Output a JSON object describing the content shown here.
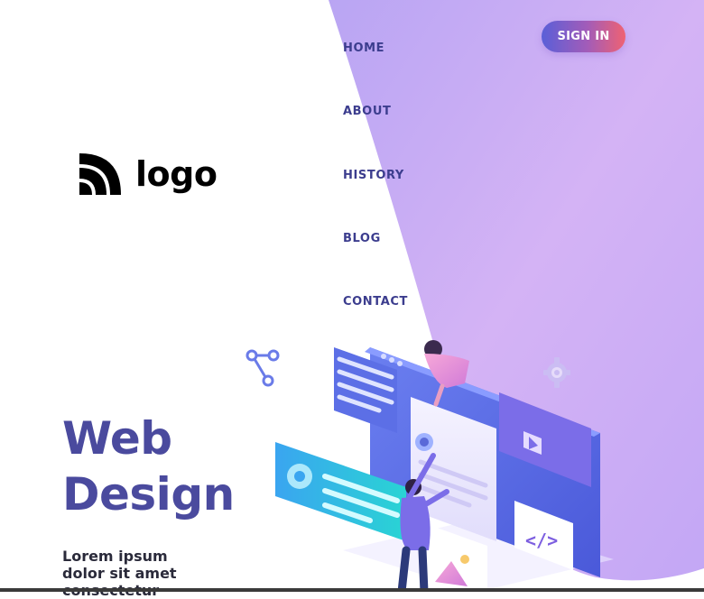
{
  "logo": {
    "text": "logo",
    "icon": "rss-icon"
  },
  "nav": {
    "items": [
      {
        "label": "HOME"
      },
      {
        "label": "ABOUT"
      },
      {
        "label": "HISTORY"
      },
      {
        "label": "BLOG"
      },
      {
        "label": "CONTACT"
      }
    ]
  },
  "header": {
    "signin_label": "SIGN IN"
  },
  "hero": {
    "title_line1": "Web",
    "title_line2": "Design",
    "subtitle": "Lorem ipsum dolor sit amet consectetur"
  },
  "colors": {
    "accent_purple": "#c7a9f6",
    "nav_text": "#3c3d8e",
    "title": "#4a4a9e",
    "button_start": "#5a5fd8",
    "button_end": "#ef6272"
  }
}
